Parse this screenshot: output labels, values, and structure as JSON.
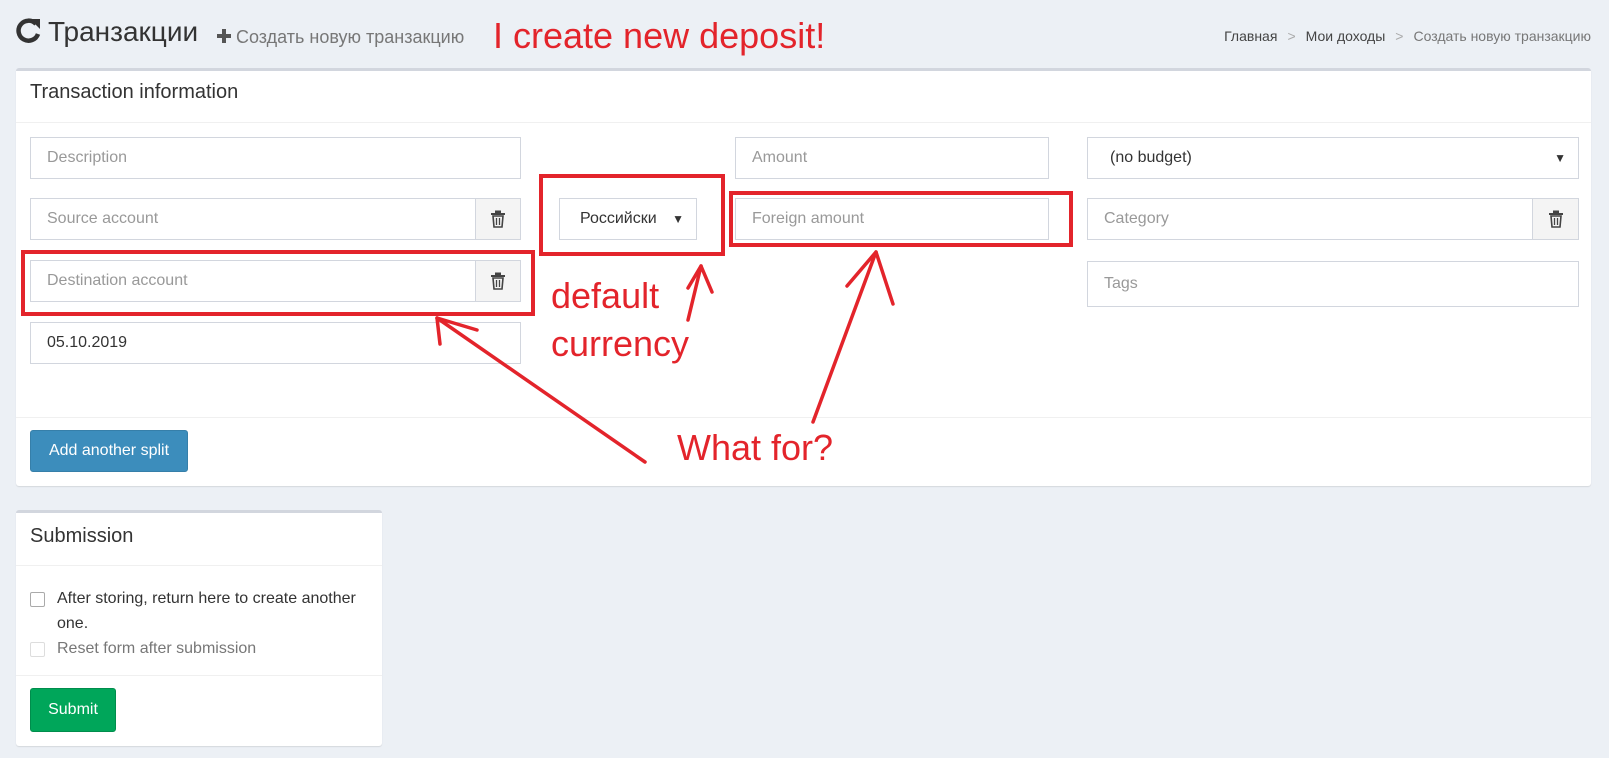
{
  "header": {
    "title": "Транзакции",
    "subtitle": "Создать новую транзакцию",
    "refresh_icon": "refresh-icon",
    "plus_icon": "plus-icon"
  },
  "breadcrumb": {
    "items": [
      "Главная",
      "Мои доходы",
      "Создать новую транзакцию"
    ],
    "separator": ">"
  },
  "transaction_box": {
    "title": "Transaction information",
    "description_placeholder": "Description",
    "source_account_placeholder": "Source account",
    "destination_account_placeholder": "Destination account",
    "date_value": "05.10.2019",
    "currency_selected": "Российски",
    "amount_placeholder": "Amount",
    "foreign_amount_placeholder": "Foreign amount",
    "budget_selected": "(no budget)",
    "category_placeholder": "Category",
    "tags_placeholder": "Tags",
    "add_split_label": "Add another split",
    "clear_icon": "trash-icon"
  },
  "submission_box": {
    "title": "Submission",
    "return_option_line1": "After storing, return here to create another",
    "return_option_line2": "one.",
    "reset_option": "Reset form after submission",
    "submit_label": "Submit"
  },
  "annotations": {
    "headline": "I create new deposit!",
    "currency_note_line1": "default",
    "currency_note_line2": "currency",
    "question": "What for?",
    "color": "#e3242b"
  },
  "colors": {
    "background": "#ecf0f5",
    "primary_button": "#3c8dbc",
    "success_button": "#00a65a"
  }
}
